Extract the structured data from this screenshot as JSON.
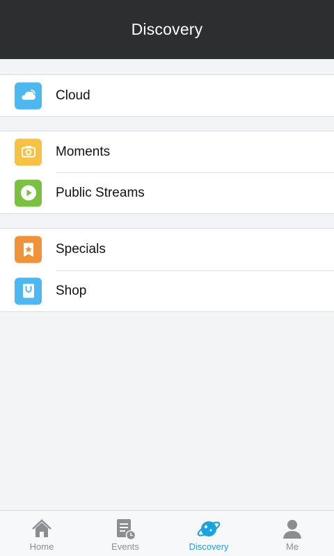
{
  "header": {
    "title": "Discovery"
  },
  "groups": [
    {
      "items": [
        {
          "label": "Cloud",
          "icon": "cloud-icon",
          "color": "#4db8ef"
        }
      ]
    },
    {
      "items": [
        {
          "label": "Moments",
          "icon": "camera-icon",
          "color": "#f5c243"
        },
        {
          "label": "Public Streams",
          "icon": "play-icon",
          "color": "#7ac142"
        }
      ]
    },
    {
      "items": [
        {
          "label": "Specials",
          "icon": "star-bookmark-icon",
          "color": "#f0923a"
        },
        {
          "label": "Shop",
          "icon": "shopping-bag-icon",
          "color": "#4db8ef"
        }
      ]
    }
  ],
  "tabbar": {
    "tabs": [
      {
        "label": "Home",
        "icon": "home-icon",
        "active": false
      },
      {
        "label": "Events",
        "icon": "events-icon",
        "active": false
      },
      {
        "label": "Discovery",
        "icon": "planet-icon",
        "active": true
      },
      {
        "label": "Me",
        "icon": "person-icon",
        "active": false
      }
    ],
    "active_color": "#1aa3e0",
    "inactive_color": "#8a8e92"
  }
}
